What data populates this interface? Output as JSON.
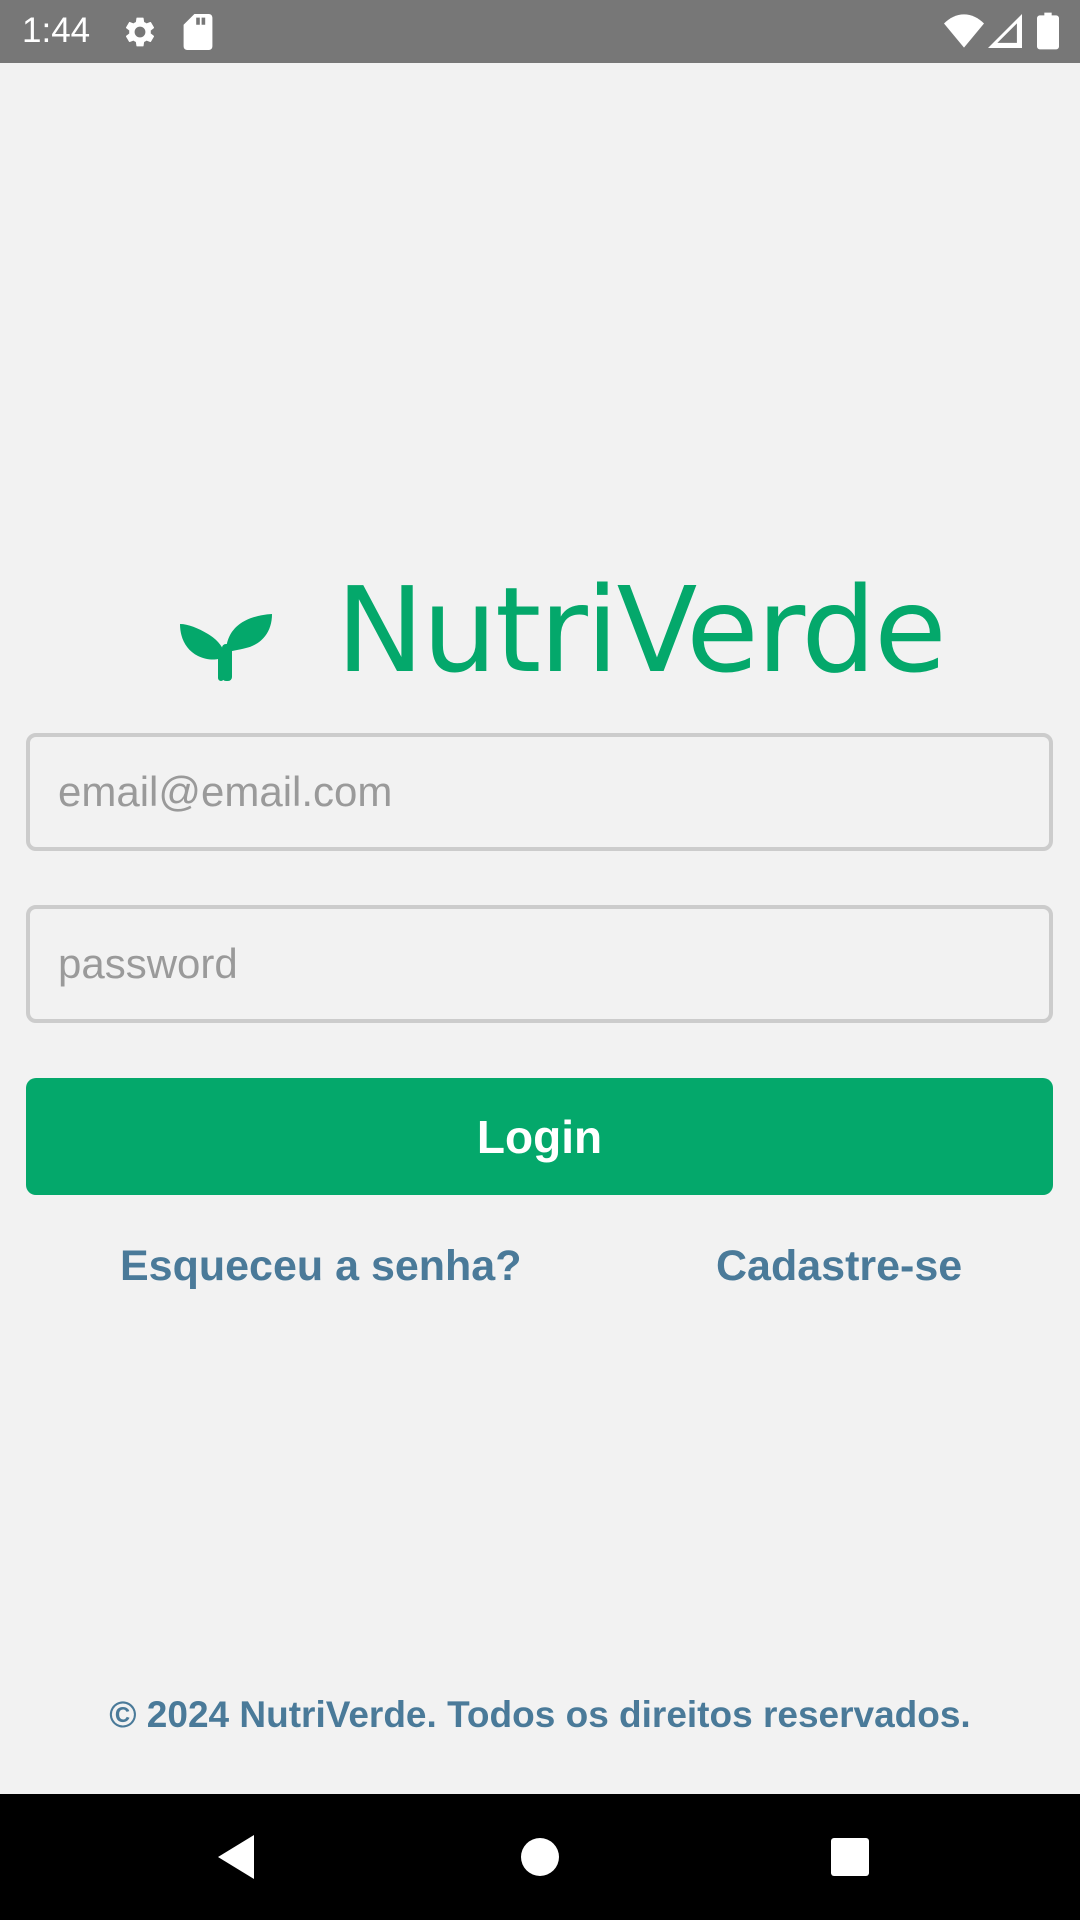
{
  "status_bar": {
    "time": "1:44",
    "icons": [
      "gear-icon",
      "sd-card-icon",
      "wifi-icon",
      "signal-icon",
      "battery-icon"
    ],
    "background": "#777777"
  },
  "logo": {
    "icon": "sprout-icon",
    "text": "NutriVerde",
    "color": "#04a86b"
  },
  "form": {
    "email_placeholder": "email@email.com",
    "email_value": "",
    "password_placeholder": "password",
    "password_value": "",
    "login_label": "Login",
    "button_color": "#04a86b"
  },
  "links": {
    "forgot_password": "Esqueceu a senha?",
    "signup": "Cadastre-se",
    "color": "#4a7a99"
  },
  "footer": {
    "copyright": "© 2024 NutriVerde. Todos os direitos reservados."
  },
  "nav_bar": {
    "icons": [
      "back-icon",
      "home-icon",
      "recents-icon"
    ]
  }
}
